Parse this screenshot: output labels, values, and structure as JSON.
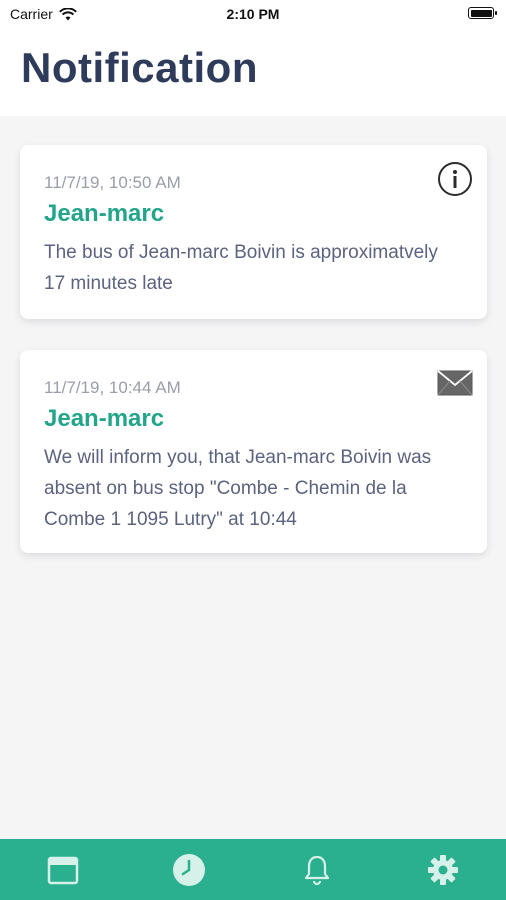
{
  "status_bar": {
    "carrier": "Carrier",
    "time": "2:10 PM"
  },
  "header": {
    "title": "Notification"
  },
  "notifications": [
    {
      "timestamp": "11/7/19, 10:50 AM",
      "name": "Jean-marc",
      "message": "The bus of Jean-marc Boivin is approximatvely 17 minutes late",
      "icon": "info-icon"
    },
    {
      "timestamp": "11/7/19, 10:44 AM",
      "name": "Jean-marc",
      "message": "We will inform you, that Jean-marc Boivin was absent on bus stop \"Combe - Chemin de la Combe 1 1095 Lutry\" at 10:44",
      "icon": "envelope-icon"
    }
  ],
  "tabbar": {
    "items": [
      {
        "icon": "calendar-icon"
      },
      {
        "icon": "clock-icon"
      },
      {
        "icon": "bell-icon"
      },
      {
        "icon": "gear-icon"
      }
    ]
  },
  "colors": {
    "accent": "#2ab08e",
    "name_green": "#23a58a",
    "title": "#2f3b5b",
    "background": "#f5f5f6"
  }
}
